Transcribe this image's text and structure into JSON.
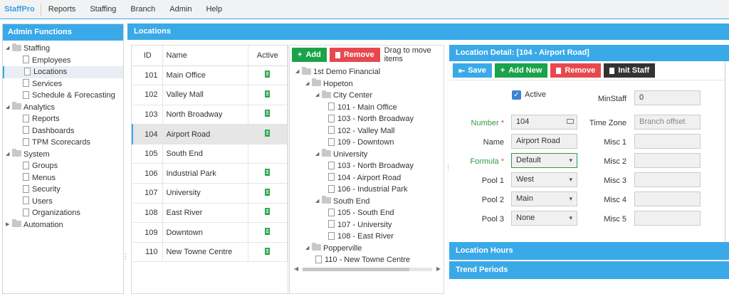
{
  "menu": {
    "brand": "StaffPro",
    "items": [
      {
        "label": "Reports",
        "name": "menu-reports"
      },
      {
        "label": "Staffing",
        "name": "menu-staffing"
      },
      {
        "label": "Branch",
        "name": "menu-branch"
      },
      {
        "label": "Admin",
        "name": "menu-admin"
      },
      {
        "label": "Help",
        "name": "menu-help"
      }
    ]
  },
  "admin": {
    "title": "Admin Functions",
    "tree": [
      {
        "label": "Staffing",
        "type": "folder",
        "level": 0,
        "expanded": true
      },
      {
        "label": "Employees",
        "type": "doc",
        "level": 1
      },
      {
        "label": "Locations",
        "type": "doc",
        "level": 1,
        "selected": true
      },
      {
        "label": "Services",
        "type": "doc",
        "level": 1
      },
      {
        "label": "Schedule & Forecasting",
        "type": "doc",
        "level": 1
      },
      {
        "label": "Analytics",
        "type": "folder",
        "level": 0,
        "expanded": true
      },
      {
        "label": "Reports",
        "type": "doc",
        "level": 1
      },
      {
        "label": "Dashboards",
        "type": "doc",
        "level": 1
      },
      {
        "label": "TPM Scorecards",
        "type": "doc",
        "level": 1
      },
      {
        "label": "System",
        "type": "folder",
        "level": 0,
        "expanded": true
      },
      {
        "label": "Groups",
        "type": "doc",
        "level": 1
      },
      {
        "label": "Menus",
        "type": "doc",
        "level": 1
      },
      {
        "label": "Security",
        "type": "doc",
        "level": 1
      },
      {
        "label": "Users",
        "type": "doc",
        "level": 1
      },
      {
        "label": "Organizations",
        "type": "doc",
        "level": 1
      },
      {
        "label": "Automation",
        "type": "folder",
        "level": 0,
        "expanded": false
      }
    ]
  },
  "locations": {
    "title": "Locations",
    "columns": {
      "id": "ID",
      "name": "Name",
      "active": "Active"
    },
    "rows": [
      {
        "id": "101",
        "name": "Main Office",
        "active": true
      },
      {
        "id": "102",
        "name": "Valley Mall",
        "active": true
      },
      {
        "id": "103",
        "name": "North Broadway",
        "active": true
      },
      {
        "id": "104",
        "name": "Airport Road",
        "active": true,
        "selected": true
      },
      {
        "id": "105",
        "name": "South End",
        "active": false
      },
      {
        "id": "106",
        "name": "Industrial Park",
        "active": true
      },
      {
        "id": "107",
        "name": "University",
        "active": true
      },
      {
        "id": "108",
        "name": "East River",
        "active": true
      },
      {
        "id": "109",
        "name": "Downtown",
        "active": true
      },
      {
        "id": "110",
        "name": "New Towne Centre",
        "active": true
      }
    ],
    "active_icon": "building-icon",
    "active_color": "#2fa84f"
  },
  "tree_panel": {
    "add_label": "Add",
    "remove_label": "Remove",
    "hint": "Drag to move items",
    "nodes": [
      {
        "label": "1st Demo Financial",
        "type": "folder",
        "level": 0
      },
      {
        "label": "Hopeton",
        "type": "folder",
        "level": 1
      },
      {
        "label": "City Center",
        "type": "folder",
        "level": 2
      },
      {
        "label": "101 - Main Office",
        "type": "doc",
        "level": 3
      },
      {
        "label": "103 - North Broadway",
        "type": "doc",
        "level": 3
      },
      {
        "label": "102 - Valley Mall",
        "type": "doc",
        "level": 3
      },
      {
        "label": "109 - Downtown",
        "type": "doc",
        "level": 3
      },
      {
        "label": "University",
        "type": "folder",
        "level": 2
      },
      {
        "label": "103 - North Broadway",
        "type": "doc",
        "level": 3
      },
      {
        "label": "104 - Airport Road",
        "type": "doc",
        "level": 3
      },
      {
        "label": "106 - Industrial Park",
        "type": "doc",
        "level": 3
      },
      {
        "label": "South End",
        "type": "folder",
        "level": 2
      },
      {
        "label": "105 - South End",
        "type": "doc",
        "level": 3
      },
      {
        "label": "107 - University",
        "type": "doc",
        "level": 3
      },
      {
        "label": "108 - East River",
        "type": "doc",
        "level": 3
      },
      {
        "label": "Popperville",
        "type": "folder",
        "level": 1
      },
      {
        "label": "110 - New Towne Centre",
        "type": "doc",
        "level": 2
      }
    ]
  },
  "detail": {
    "title": "Location Detail: [104 - Airport Road]",
    "save_label": "Save",
    "add_new_label": "Add New",
    "remove_label": "Remove",
    "init_staff_label": "Init Staff",
    "active_label": "Active",
    "active_checked": true,
    "number_label": "Number",
    "number_value": "104",
    "name_label": "Name",
    "name_value": "Airport Road",
    "formula_label": "Formula",
    "formula_value": "Default",
    "pool1_label": "Pool 1",
    "pool1_value": "West",
    "pool2_label": "Pool 2",
    "pool2_value": "Main",
    "pool3_label": "Pool 3",
    "pool3_value": "None",
    "minstaff_label": "MinStaff",
    "minstaff_value": "0",
    "timezone_label": "Time Zone",
    "timezone_placeholder": "Branch offset",
    "misc1_label": "Misc 1",
    "misc2_label": "Misc 2",
    "misc3_label": "Misc 3",
    "misc4_label": "Misc 4",
    "misc5_label": "Misc 5",
    "required_mark": "*"
  },
  "sections": {
    "hours": "Location Hours",
    "trend": "Trend Periods"
  },
  "colors": {
    "accent": "#3aa9e8",
    "add": "#1aa34a",
    "remove": "#e8484d",
    "init": "#333333",
    "required": "#2e9a48"
  }
}
